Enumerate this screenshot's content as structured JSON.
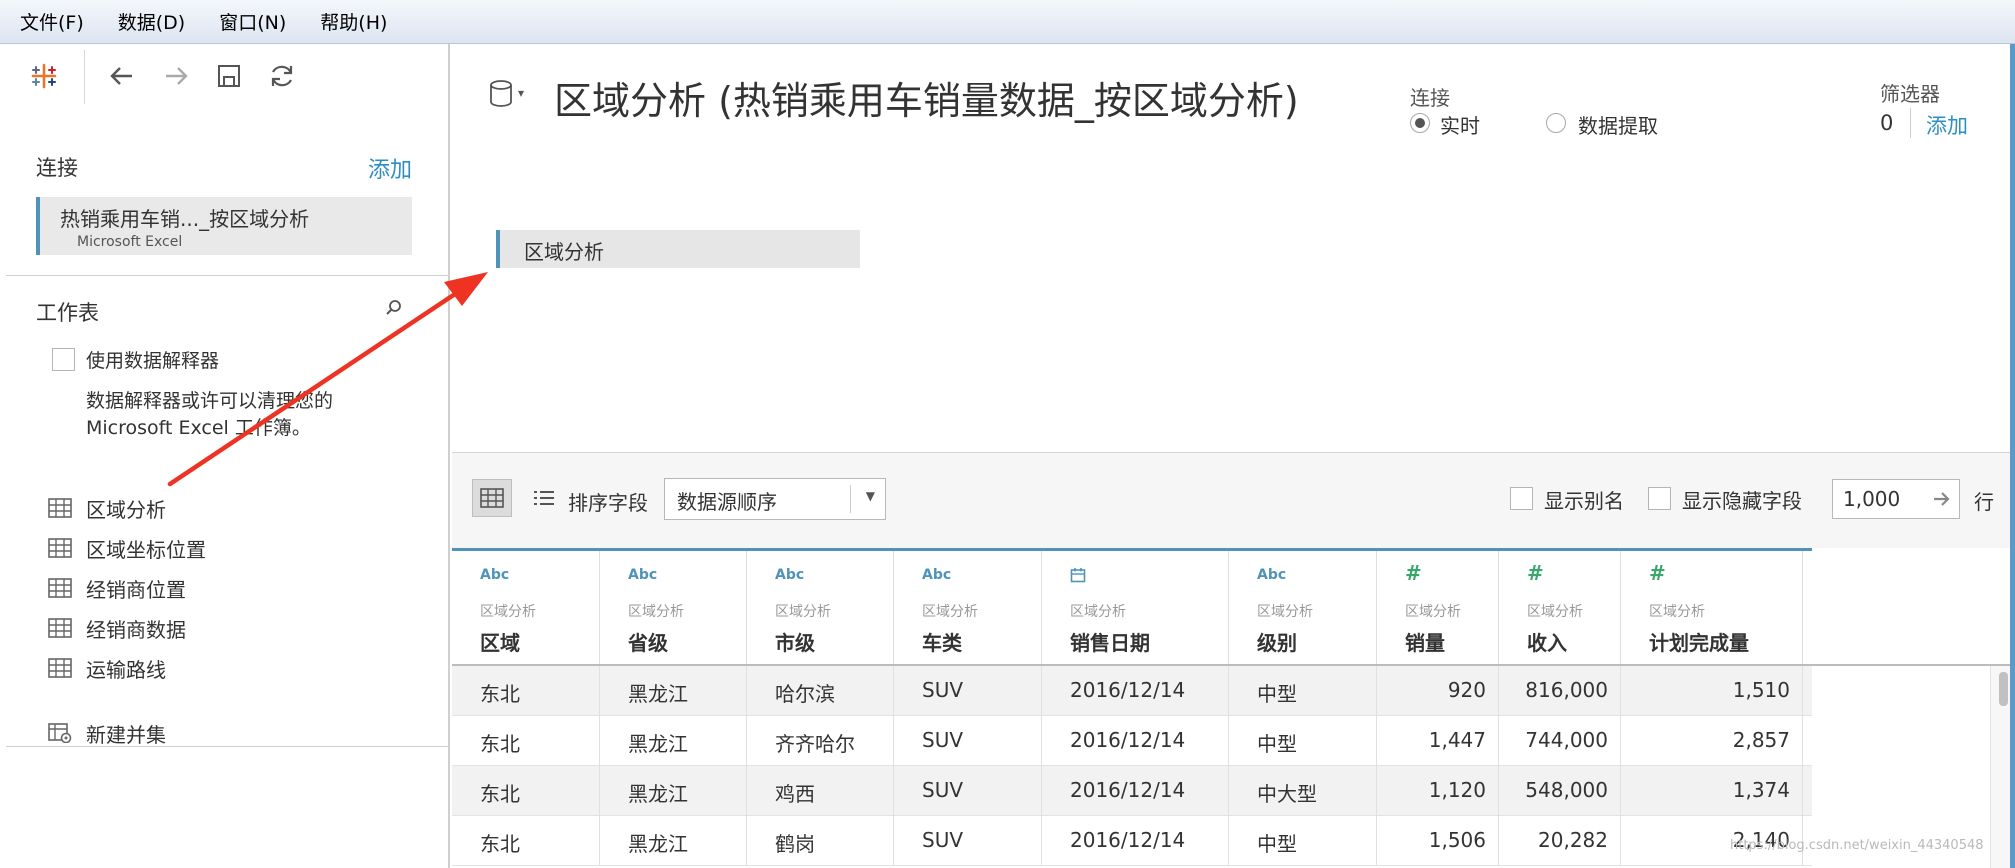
{
  "menu": [
    {
      "label": "文件(F)"
    },
    {
      "label": "数据(D)"
    },
    {
      "label": "窗口(N)"
    },
    {
      "label": "帮助(H)"
    }
  ],
  "sidebar": {
    "connections_title": "连接",
    "add_label": "添加",
    "connection": {
      "name": "热销乘用车销..._按区域分析",
      "type": "Microsoft Excel"
    },
    "sheets_title": "工作表",
    "interpreter_label": "使用数据解释器",
    "interpreter_desc": "数据解释器或许可以清理您的 Microsoft Excel 工作簿。",
    "sheets": [
      {
        "label": "区域分析"
      },
      {
        "label": "区域坐标位置"
      },
      {
        "label": "经销商位置"
      },
      {
        "label": "经销商数据"
      },
      {
        "label": "运输路线"
      }
    ],
    "new_union_label": "新建并集"
  },
  "main": {
    "title": "区域分析 (热销乘用车销量数据_按区域分析)",
    "connection_mode_label": "连接",
    "mode_live": "实时",
    "mode_extract": "数据提取",
    "filters_label": "筛选器",
    "filters_count": "0",
    "filters_add": "添加",
    "canvas_table": "区域分析"
  },
  "grid_toolbar": {
    "sort_label": "排序字段",
    "sort_value": "数据源顺序",
    "show_alias": "显示别名",
    "show_hidden": "显示隐藏字段",
    "rows_value": "1,000",
    "rows_label": "行"
  },
  "grid": {
    "columns": [
      {
        "type": "Abc",
        "source": "区域分析",
        "name": "区域"
      },
      {
        "type": "Abc",
        "source": "区域分析",
        "name": "省级"
      },
      {
        "type": "Abc",
        "source": "区域分析",
        "name": "市级"
      },
      {
        "type": "Abc",
        "source": "区域分析",
        "name": "车类"
      },
      {
        "type": "date",
        "source": "区域分析",
        "name": "销售日期"
      },
      {
        "type": "Abc",
        "source": "区域分析",
        "name": "级别"
      },
      {
        "type": "#",
        "source": "区域分析",
        "name": "销量"
      },
      {
        "type": "#",
        "source": "区域分析",
        "name": "收入"
      },
      {
        "type": "#",
        "source": "区域分析",
        "name": "计划完成量"
      }
    ],
    "rows": [
      [
        "东北",
        "黑龙江",
        "哈尔滨",
        "SUV",
        "2016/12/14",
        "中型",
        "920",
        "816,000",
        "1,510"
      ],
      [
        "东北",
        "黑龙江",
        "齐齐哈尔",
        "SUV",
        "2016/12/14",
        "中型",
        "1,447",
        "744,000",
        "2,857"
      ],
      [
        "东北",
        "黑龙江",
        "鸡西",
        "SUV",
        "2016/12/14",
        "中大型",
        "1,120",
        "548,000",
        "1,374"
      ],
      [
        "东北",
        "黑龙江",
        "鹤岗",
        "SUV",
        "2016/12/14",
        "中型",
        "1,506",
        "20,282",
        "2,140"
      ]
    ]
  },
  "colors": {
    "accent": "#4f94b8",
    "link": "#2b8fc3",
    "number_icon": "#3aa76d",
    "annotation": "#ee3322"
  },
  "watermark": "https://blog.csdn.net/weixin_44340548"
}
